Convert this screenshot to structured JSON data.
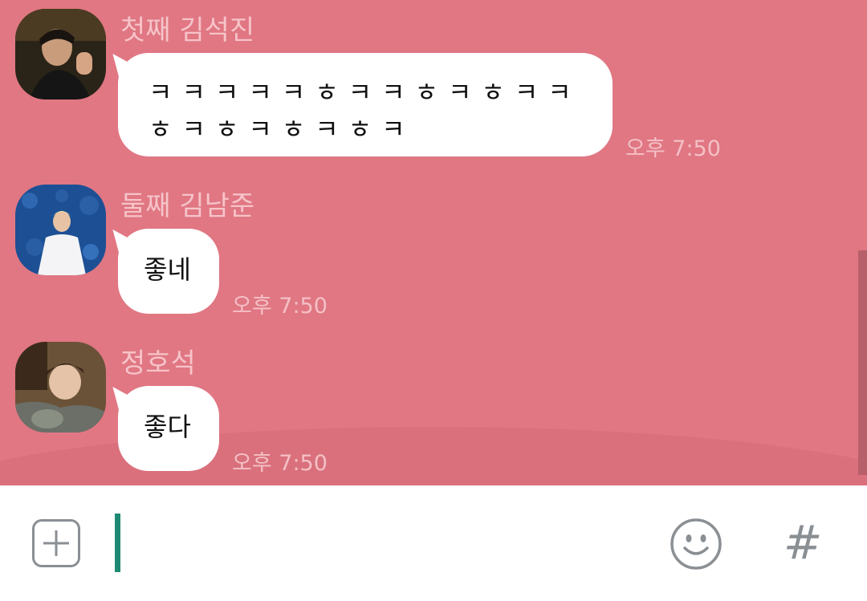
{
  "theme": {
    "chat_background": "#e07783",
    "bubble_color": "#ffffff",
    "cursor_color": "#1e8a74",
    "icon_color": "#8a8f94"
  },
  "messages": [
    {
      "sender": "첫째 김석진",
      "text": "ㅋㅋㅋㅋㅋㅎㅋㅋㅎㅋㅎㅋㅋㅎㅋㅎㅋㅎㅋㅎㅋ",
      "time": "오후 7:50",
      "avatar_icon": "profile-photo"
    },
    {
      "sender": "둘째 김남준",
      "text": "좋네",
      "time": "오후 7:50",
      "avatar_icon": "profile-photo"
    },
    {
      "sender": "정호석",
      "text": "좋다",
      "time": "오후 7:50",
      "avatar_icon": "profile-photo"
    }
  ],
  "input_bar": {
    "attach_icon": "plus-square-icon",
    "emoji_icon": "smiley-icon",
    "hashtag_icon": "#"
  }
}
